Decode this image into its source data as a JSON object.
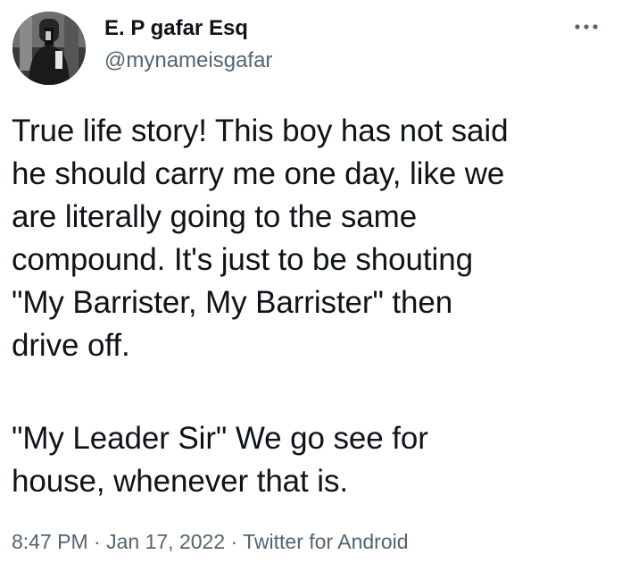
{
  "author": {
    "display_name": "E. P gafar Esq",
    "handle": "@mynameisgafar"
  },
  "icons": {
    "avatar": "profile-photo",
    "more": "more-horizontal-icon"
  },
  "tweet": {
    "paragraph_1": "True life story! This boy has not said\nhe should carry me one day, like we\nare literally going to the same\ncompound.  It's just to be shouting\n\"My Barrister, My Barrister\" then\ndrive off.",
    "paragraph_2": "\"My Leader Sir\" We go see for\nhouse, whenever that is."
  },
  "meta": {
    "time": "8:47 PM",
    "separator_1": " · ",
    "date": "Jan 17, 2022",
    "separator_2": " · ",
    "source": "Twitter for Android"
  },
  "colors": {
    "text": "#0f1419",
    "secondary": "#536471",
    "background": "#ffffff"
  }
}
